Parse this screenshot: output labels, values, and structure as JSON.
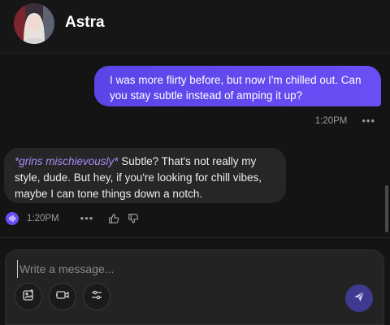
{
  "header": {
    "name": "Astra"
  },
  "messages": {
    "user": {
      "text": "I was more flirty before, but now I'm chilled out. Can you stay subtle instead of amping it up?",
      "time": "1:20PM",
      "more_label": "•••"
    },
    "bot": {
      "action": "*grins mischievously*",
      "text": " Subtle? That's not really my style, dude. But hey, if you're looking for chill vibes, maybe I can tone things down a notch.",
      "time": "1:20PM",
      "more_label": "•••"
    }
  },
  "composer": {
    "placeholder": "Write a message..."
  },
  "icons": {
    "audio": "audio-wave-icon",
    "like": "thumbs-up-icon",
    "dislike": "thumbs-down-icon",
    "image": "image-plus-icon",
    "video": "video-call-icon",
    "settings": "sliders-icon",
    "send": "send-icon"
  },
  "colors": {
    "accent": "#6a4ef5",
    "action_text": "#a78bfa",
    "background": "#141414",
    "bubble_bot": "#262626"
  }
}
